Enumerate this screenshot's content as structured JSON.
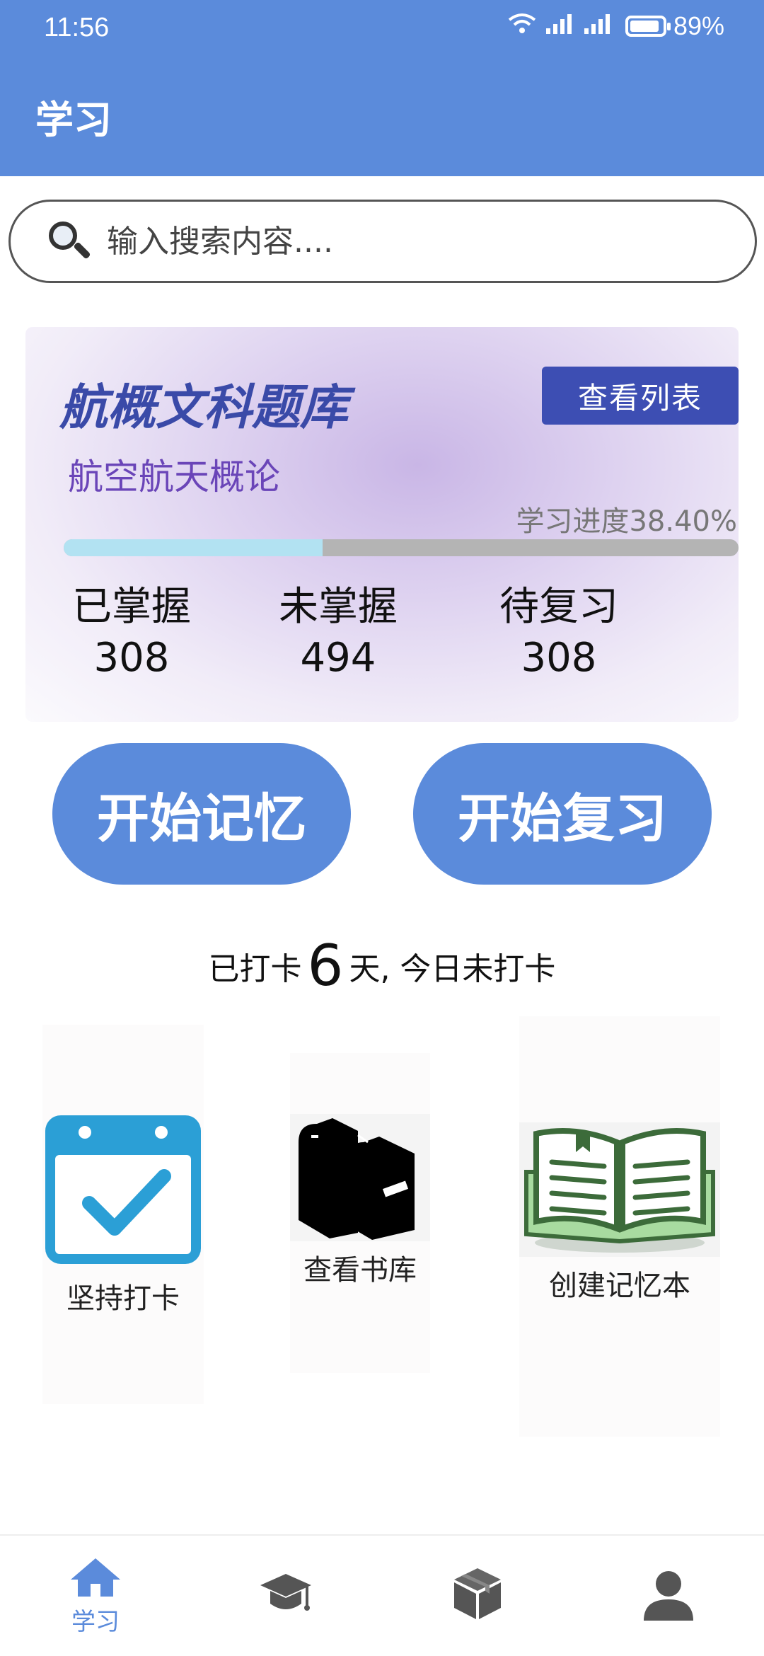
{
  "status": {
    "time": "11:56",
    "battery": "89%"
  },
  "header": {
    "title": "学习"
  },
  "search": {
    "placeholder": "输入搜索内容...."
  },
  "library_card": {
    "title": "航概文科题库",
    "subtitle": "航空航天概论",
    "view_list_label": "查看列表",
    "progress_text": "学习进度38.40%",
    "progress_percent": 38.4,
    "stats": [
      {
        "label": "已掌握",
        "value": "308"
      },
      {
        "label": "未掌握",
        "value": "494"
      },
      {
        "label": "待复习",
        "value": "308"
      }
    ]
  },
  "actions": {
    "start_memory": "开始记忆",
    "start_review": "开始复习"
  },
  "checkin": {
    "prefix": "已打卡",
    "days": "6",
    "suffix": "天, 今日未打卡"
  },
  "features": [
    {
      "label": "坚持打卡",
      "icon": "calendar-check-icon"
    },
    {
      "label": "查看书库",
      "icon": "books-icon"
    },
    {
      "label": "创建记忆本",
      "icon": "open-book-icon"
    }
  ],
  "bottom_nav": [
    {
      "label": "学习",
      "icon": "home-icon",
      "active": true
    },
    {
      "label": "",
      "icon": "graduation-cap-icon",
      "active": false
    },
    {
      "label": "",
      "icon": "box-icon",
      "active": false
    },
    {
      "label": "",
      "icon": "user-icon",
      "active": false
    }
  ],
  "colors": {
    "primary": "#5b8bdb",
    "card_button": "#3d4eb3",
    "card_title": "#3a4aa8",
    "progress_fill": "#b2e2f2"
  }
}
